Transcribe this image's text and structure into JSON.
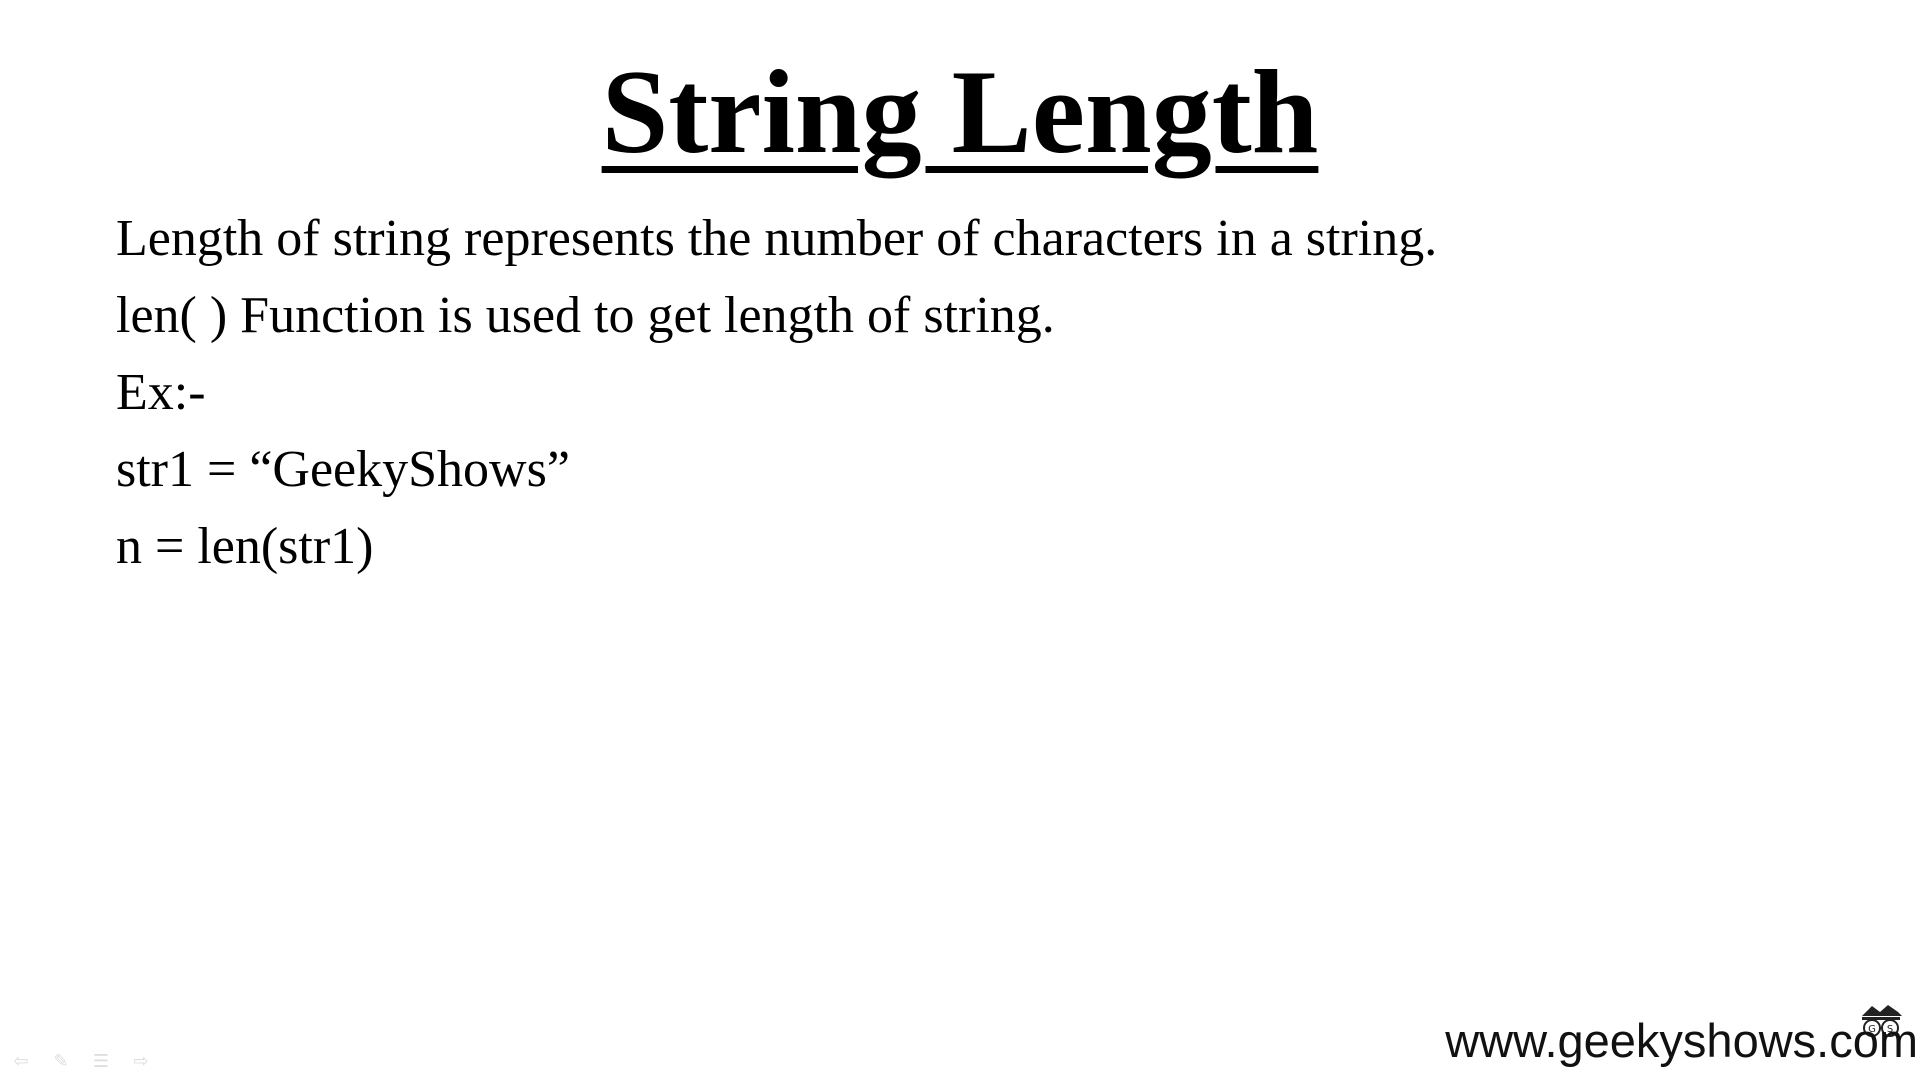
{
  "slide": {
    "title": "String Length",
    "lines": [
      "Length of string represents the number of characters in a string.",
      "len( ) Function is used to get length of string.",
      "Ex:-",
      "str1 = “GeekyShows”",
      "n = len(str1)"
    ]
  },
  "watermark": {
    "text": "www.geekyshows.com",
    "logo_letters": "GS"
  },
  "controls": {
    "previous_icon": "arrow-left-icon",
    "pen_icon": "pen-icon",
    "menu_icon": "menu-icon",
    "next_icon": "arrow-right-icon"
  },
  "colors": {
    "background": "#ffffff",
    "text": "#000000",
    "control_icons": "#777777"
  }
}
